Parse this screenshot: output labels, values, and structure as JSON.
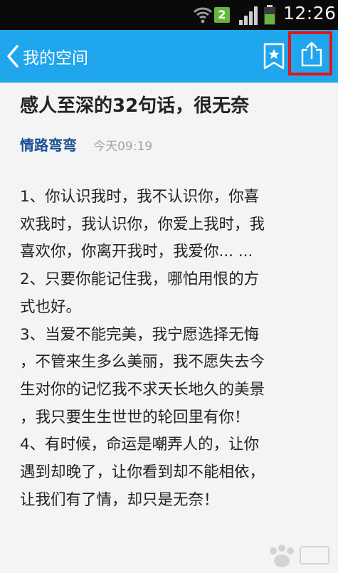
{
  "status_bar": {
    "time": "12:26",
    "sim_badge": "2"
  },
  "nav": {
    "back_label": "我的空间"
  },
  "article": {
    "title": "感人至深的32句话，很无奈",
    "author": "情路弯弯",
    "time": "今天09:19",
    "lines": [
      "1、你认识我时，我不认识你，你喜",
      "欢我时，我认识你，你爱上我时，我",
      "喜欢你，你离开我时，我爱你... ...",
      "2、只要你能记住我，哪怕用恨的方",
      "式也好。",
      "3、当爱不能完美，我宁愿选择无悔",
      "，不管来生多么美丽，我不愿失去今",
      "生对你的记忆我不求天长地久的美景",
      "，我只要生生世世的轮回里有你！",
      "4、有时候，命运是嘲弄人的，让你",
      "遇到却晚了，让你看到却不能相依，",
      "让我们有了情，却只是无奈！"
    ]
  },
  "colors": {
    "nav_bg": "#1fa6ec",
    "highlight_border": "#e3141b",
    "author": "#1b4e94"
  }
}
